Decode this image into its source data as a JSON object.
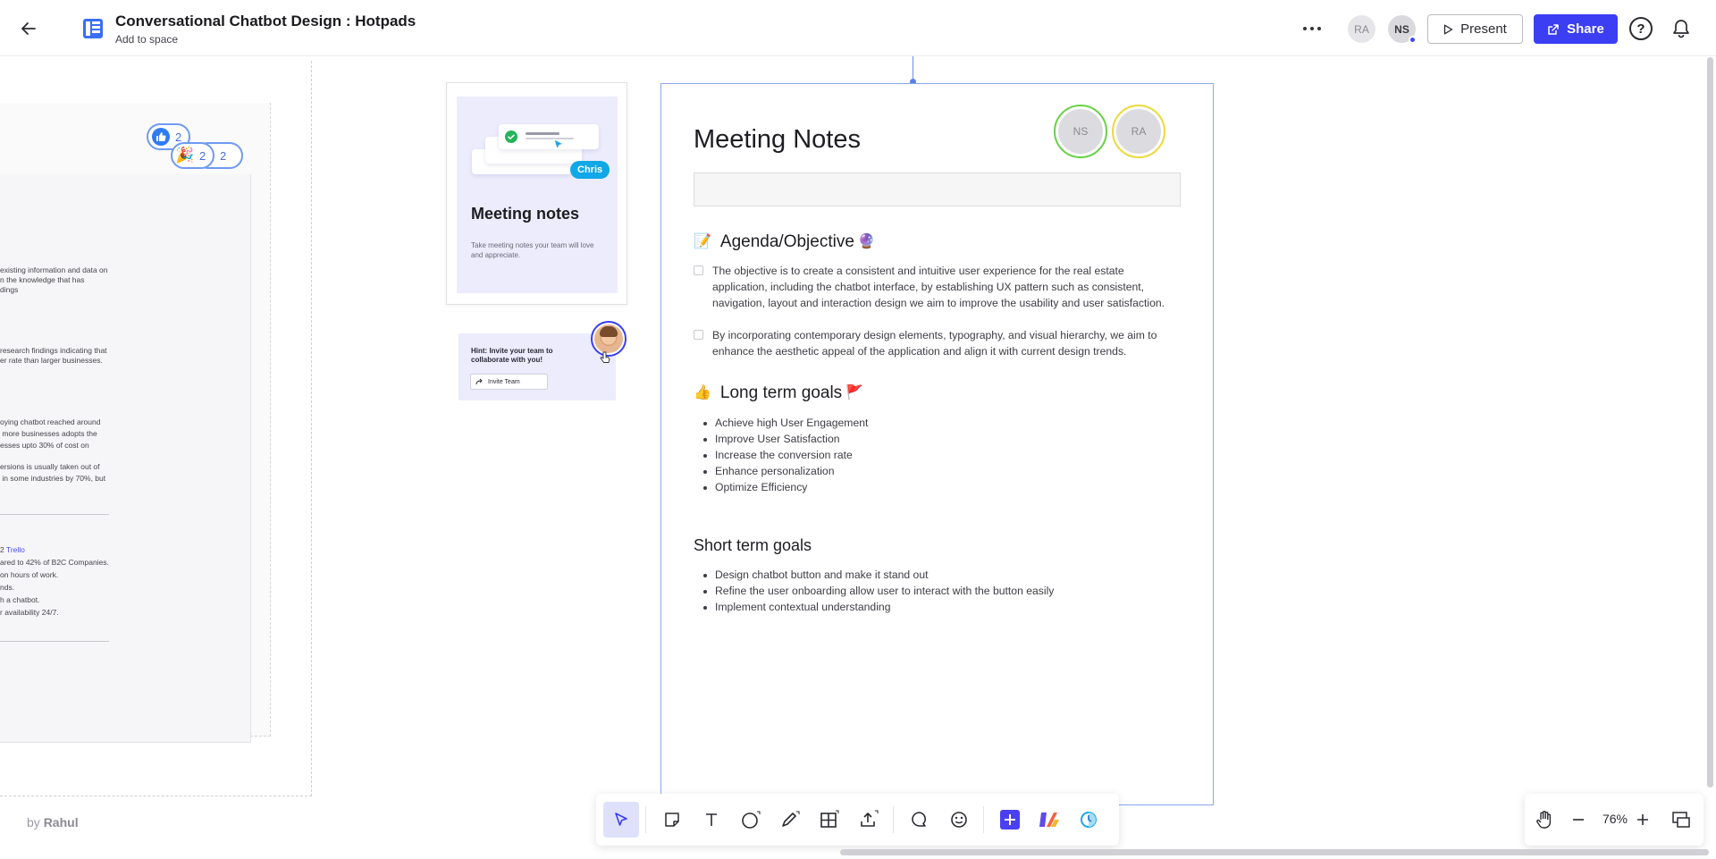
{
  "header": {
    "title": "Conversational Chatbot Design : Hotpads",
    "subtitle": "Add to space",
    "avatars": [
      "RA",
      "NS"
    ],
    "present_label": "Present",
    "share_label": "Share",
    "help_label": "?",
    "accent_color": "#3b3ef2"
  },
  "left_frame": {
    "text_lines": [
      "existing information and data on",
      "n the knowledge that has",
      "dings",
      "research findings indicating that",
      "er rate than larger businesses.",
      "oying chatbot reached around",
      " more businesses adopts the",
      "esses upto 30% of cost on",
      "ersions is usually taken out of",
      " in some industries by 70%, but",
      "2 ",
      "ared to 42% of B2C Companies.",
      "on hours of work.",
      "nds.",
      "h a chatbot.",
      "r availability 24/7."
    ],
    "link_text": "Trello",
    "reactions": [
      {
        "icon": "thumbs-up",
        "count": "2"
      },
      {
        "icon": "party-popper",
        "count": "2"
      },
      {
        "icon": "blank",
        "count": "2"
      }
    ],
    "by_prefix": "by",
    "author": "Rahul"
  },
  "template_card": {
    "title": "Meeting notes",
    "description": "Take meeting notes your team will love and appreciate.",
    "cursor_label": "Chris"
  },
  "hint_card": {
    "text_line1": "Hint: Invite your team to",
    "text_line2": "collaborate with you!",
    "button_label": "Invite Team"
  },
  "document": {
    "title": "Meeting Notes",
    "participants": [
      "NS",
      "RA"
    ],
    "agenda_heading": "Agenda/Objective",
    "agenda_items": [
      "The objective is to create a consistent and intuitive user experience for the real estate application, including the chatbot interface, by establishing UX pattern such as consistent, navigation, layout and interaction design we aim to improve the usability and user satisfaction.",
      "By incorporating contemporary design elements, typography, and visual hierarchy, we aim to enhance the aesthetic appeal of the application and align it with current design trends."
    ],
    "long_term_heading": "Long term goals",
    "long_term_goals": [
      "Achieve high User Engagement",
      "Improve User Satisfaction",
      "Increase the conversion rate",
      "Enhance personalization",
      "Optimize Efficiency"
    ],
    "short_term_heading": "Short term goals",
    "short_term_goals": [
      "Design chatbot button and make it stand out",
      "Refine the user onboarding allow user to interact with the button easily",
      "Implement contextual understanding"
    ]
  },
  "toolbar": {
    "tools": [
      "select",
      "sticky-note",
      "text",
      "shape",
      "pen",
      "table",
      "upload",
      "comment",
      "sticker",
      "add",
      "apps",
      "timer"
    ]
  },
  "zoom": {
    "value": "76%"
  }
}
